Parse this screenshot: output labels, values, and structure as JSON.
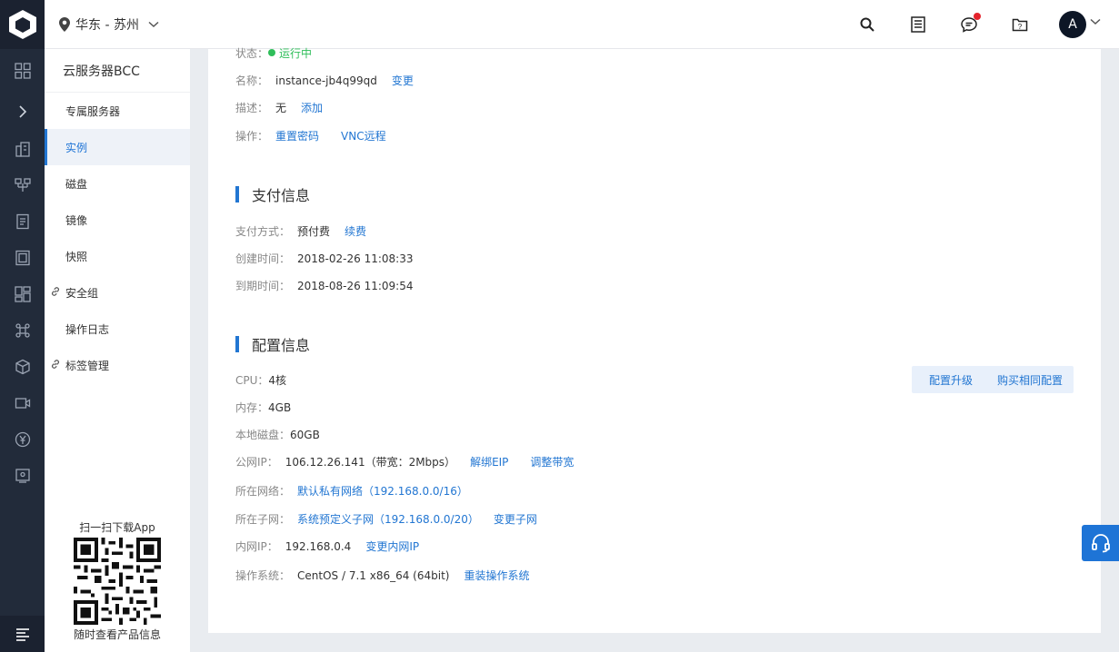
{
  "header": {
    "region": "华东 - 苏州",
    "avatar_letter": "A"
  },
  "sidebar": {
    "title": "云服务器BCC",
    "items": [
      {
        "label": "专属服务器",
        "active": false,
        "link": false
      },
      {
        "label": "实例",
        "active": true,
        "link": false
      },
      {
        "label": "磁盘",
        "active": false,
        "link": false
      },
      {
        "label": "镜像",
        "active": false,
        "link": false
      },
      {
        "label": "快照",
        "active": false,
        "link": false
      },
      {
        "label": "安全组",
        "active": false,
        "link": true
      },
      {
        "label": "操作日志",
        "active": false,
        "link": false
      },
      {
        "label": "标签管理",
        "active": false,
        "link": true
      }
    ],
    "qr_top_caption": "扫一扫下载App",
    "qr_bottom_caption": "随时查看产品信息"
  },
  "basic": {
    "status_label": "状态：",
    "status_value": "运行中",
    "name_label": "名称：",
    "name_value": "instance-jb4q99qd",
    "name_action": "变更",
    "desc_label": "描述：",
    "desc_value": "无",
    "desc_action": "添加",
    "ops_label": "操作：",
    "ops_action_1": "重置密码",
    "ops_action_2": "VNC远程"
  },
  "payment": {
    "title": "支付信息",
    "method_label": "支付方式：",
    "method_value": "预付费",
    "method_action": "续费",
    "created_label": "创建时间：",
    "created_value": "2018-02-26 11:08:33",
    "expire_label": "到期时间：",
    "expire_value": "2018-08-26 11:09:54"
  },
  "config": {
    "title": "配置信息",
    "upgrade_button": "配置升级",
    "buy_same_button": "购买相同配置",
    "cpu_label": "CPU：",
    "cpu_value": "4核",
    "mem_label": "内存：",
    "mem_value": "4GB",
    "disk_label": "本地磁盘：",
    "disk_value": "60GB",
    "pubip_label": "公网IP：",
    "pubip_value": "106.12.26.141（带宽：2Mbps）",
    "pubip_action_1": "解绑EIP",
    "pubip_action_2": "调整带宽",
    "net_label": "所在网络：",
    "net_value": "默认私有网络（192.168.0.0/16）",
    "subnet_label": "所在子网：",
    "subnet_value": "系统预定义子网（192.168.0.0/20）",
    "subnet_action": "变更子网",
    "privip_label": "内网IP：",
    "privip_value": "192.168.0.4",
    "privip_action": "变更内网IP",
    "os_label": "操作系统：",
    "os_value": "CentOS / 7.1 x86_64 (64bit)",
    "os_action": "重装操作系统"
  },
  "colors": {
    "accent": "#2276d2",
    "status_green": "#2fbe5a",
    "rail_bg": "#222b3a",
    "notification_red": "#e4232c"
  }
}
